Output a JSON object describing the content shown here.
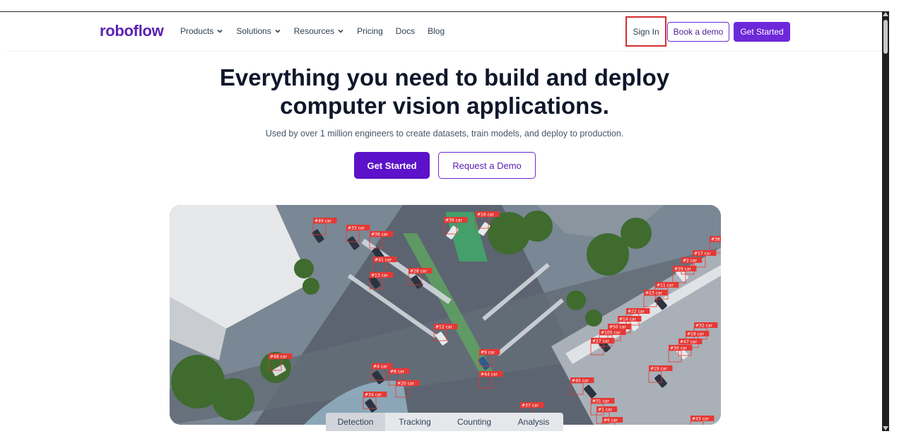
{
  "nav": {
    "logo": "roboflow",
    "links": [
      {
        "label": "Products",
        "dropdown": true
      },
      {
        "label": "Solutions",
        "dropdown": true
      },
      {
        "label": "Resources",
        "dropdown": true
      },
      {
        "label": "Pricing",
        "dropdown": false
      },
      {
        "label": "Docs",
        "dropdown": false
      },
      {
        "label": "Blog",
        "dropdown": false
      }
    ],
    "sign_in": "Sign In",
    "book_demo": "Book a demo",
    "get_started": "Get Started"
  },
  "hero": {
    "title_line1": "Everything you need to build and deploy",
    "title_line2": "computer vision applications.",
    "subtitle": "Used by over 1 million engineers to create datasets, train models, and deploy to production.",
    "cta_primary": "Get Started",
    "cta_secondary": "Request a Demo"
  },
  "video": {
    "detections": [
      "#49 car",
      "#33 car",
      "#36 car",
      "#39 car",
      "#16 car",
      "#41 car",
      "#28 car",
      "#13 car",
      "#17 car",
      "#2 car",
      "#29 car",
      "#11 car",
      "#23 car",
      "#22 car",
      "#14 car",
      "#50 car",
      "#105 car",
      "#27 car",
      "#12 car",
      "#32 car",
      "#18 car",
      "#47 car",
      "#30 car",
      "#9 car",
      "#44 car",
      "#48 car",
      "#4 car",
      "#8 car",
      "#20 car",
      "#34 car",
      "#40 car",
      "#19 car",
      "#31 car",
      "#1 car",
      "#6 car",
      "#37 car",
      "#43 car",
      "#38"
    ]
  },
  "tabs": [
    {
      "label": "Detection",
      "active": true
    },
    {
      "label": "Tracking",
      "active": false
    },
    {
      "label": "Counting",
      "active": false
    },
    {
      "label": "Analysis",
      "active": false
    }
  ],
  "colors": {
    "brand": "#6d28d9",
    "brand_dark": "#5b12c9",
    "highlight": "#d32f2f",
    "detection": "#e53935"
  }
}
